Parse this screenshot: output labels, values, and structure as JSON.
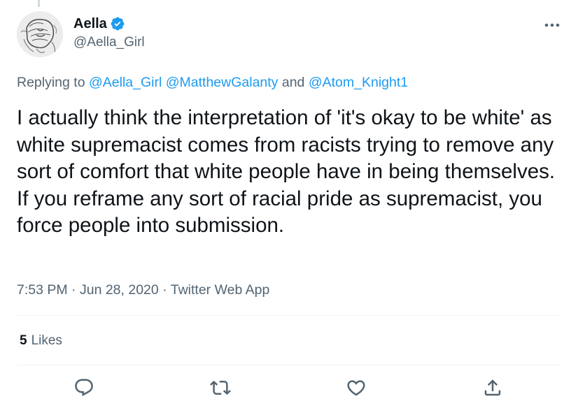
{
  "tweet": {
    "author": {
      "display_name": "Aella",
      "handle": "@Aella_Girl",
      "verified": true,
      "avatar": "sketch-portrait-avatar"
    },
    "reply": {
      "prefix": "Replying to",
      "mentions": [
        "@Aella_Girl",
        "@MatthewGalanty",
        "@Atom_Knight1"
      ],
      "conjunction": "and"
    },
    "text": "I actually think the interpretation of 'it's okay to be white' as white supremacist comes from racists trying to remove any sort of comfort that white people have in being themselves. If you reframe any sort of racial pride as supremacist, you force people into submission.",
    "time": "7:53 PM",
    "date": "Jun 28, 2020",
    "source": "Twitter Web App",
    "separator": "·",
    "likes": {
      "count": "5",
      "label": "Likes"
    }
  },
  "actions": [
    {
      "name": "reply",
      "icon": "reply-icon"
    },
    {
      "name": "retweet",
      "icon": "retweet-icon"
    },
    {
      "name": "like",
      "icon": "heart-icon"
    },
    {
      "name": "share",
      "icon": "share-icon"
    }
  ],
  "colors": {
    "text": "#0f1419",
    "secondary": "#536471",
    "link": "#1d9bf0",
    "divider": "#eff3f4",
    "verified": "#1d9bf0"
  }
}
